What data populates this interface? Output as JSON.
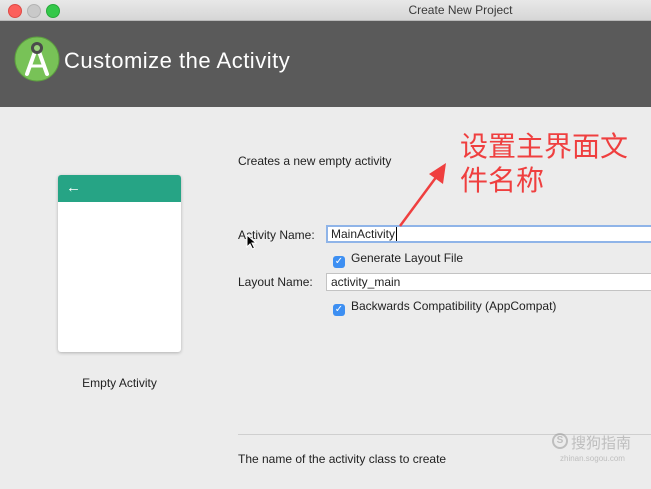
{
  "window": {
    "title": "Create New Project"
  },
  "header": {
    "title": "Customize the Activity",
    "logo_icon": "android-studio-icon"
  },
  "preview": {
    "back_icon": "arrow-left-icon",
    "template_name": "Empty Activity",
    "bar_color": "#26a485"
  },
  "form": {
    "description": "Creates a new empty activity",
    "activity_name_label": "Activity Name:",
    "activity_name_value": "MainActivity",
    "generate_layout_label": "Generate Layout File",
    "generate_layout_checked": true,
    "layout_name_label": "Layout Name:",
    "layout_name_value": "activity_main",
    "backwards_compat_label": "Backwards Compatibility (AppCompat)",
    "backwards_compat_checked": true
  },
  "hint": "The name of the activity class to create",
  "annotation": {
    "line1": "设置主界面文",
    "line2": "件名称",
    "color": "#ef3f3f"
  },
  "watermark": {
    "text": "搜狗指南",
    "sub": "zhinan.sogou.com"
  }
}
